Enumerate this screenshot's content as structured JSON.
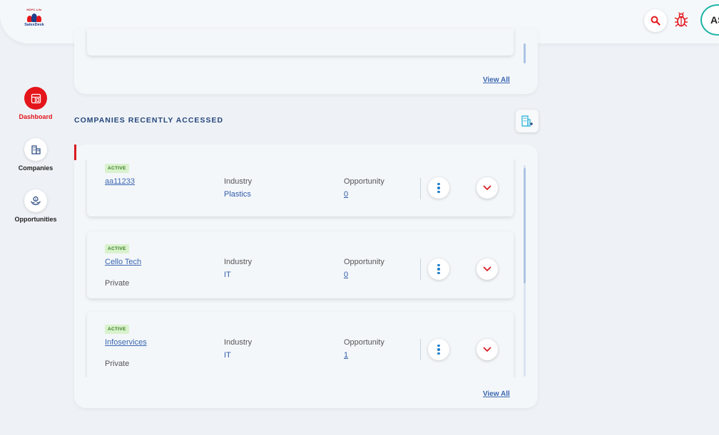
{
  "header": {
    "logo_top_text": "HDFC Life",
    "logo_text": "SalesDesk",
    "avatar_initials": "AS",
    "icons": {
      "search": "search-icon",
      "bug": "bug-icon"
    }
  },
  "sidebar": {
    "items": [
      {
        "label": "Dashboard",
        "icon": "dashboard-icon",
        "active": true
      },
      {
        "label": "Companies",
        "icon": "companies-icon",
        "active": false
      },
      {
        "label": "Opportunities",
        "icon": "opportunities-icon",
        "active": false
      }
    ]
  },
  "top_panel": {
    "view_all": "View All"
  },
  "recent_companies": {
    "title": "COMPANIES RECENTLY ACCESSED",
    "view_all": "View All",
    "industry_label": "Industry",
    "opportunity_label": "Opportunity",
    "rows": [
      {
        "status": "ACTIVE",
        "name": "aa11233",
        "type": "",
        "industry": "Plastics",
        "opportunity": "0"
      },
      {
        "status": "ACTIVE",
        "name": "Cello Tech",
        "type": "Private",
        "industry": "IT",
        "opportunity": "0"
      },
      {
        "status": "ACTIVE",
        "name": "Infoservices",
        "type": "Private",
        "industry": "IT",
        "opportunity": "1"
      }
    ]
  },
  "colors": {
    "accent_red": "#e4151b",
    "link_blue": "#3a66b0",
    "title_navy": "#26467d",
    "badge_green": "#d9f2cd",
    "teal_ring": "#1fb5a7"
  }
}
